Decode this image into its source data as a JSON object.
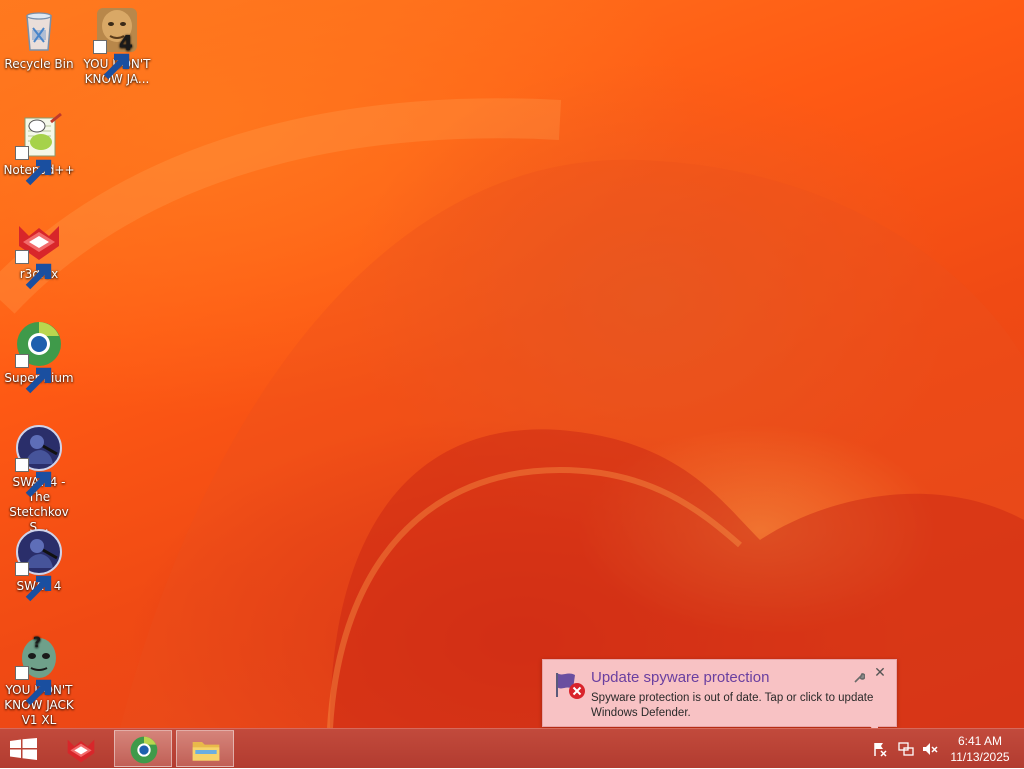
{
  "desktop": {
    "icons": [
      {
        "label": "Recycle Bin",
        "icon": "recycle-bin-icon"
      },
      {
        "label": "YOU DON'T KNOW JA...",
        "icon": "you-dont-know-jack-4-icon"
      },
      {
        "label": "Notepad++",
        "icon": "notepad-plus-plus-icon"
      },
      {
        "label": "r3dfox",
        "icon": "r3dfox-icon"
      },
      {
        "label": "Supermium",
        "icon": "supermium-icon"
      },
      {
        "label": "SWAT 4 - The Stetchkov S...",
        "icon": "swat-4-stetchkov-icon"
      },
      {
        "label": "SWAT 4",
        "icon": "swat-4-icon"
      },
      {
        "label": "YOU DON'T KNOW JACK V1 XL",
        "icon": "you-dont-know-jack-v1-xl-icon"
      }
    ]
  },
  "notification": {
    "title": "Update spyware protection",
    "message": "Spyware protection is out of date. Tap or click to update Windows Defender.",
    "icon": "windows-defender-error-icon",
    "accent_color": "#6a3fa0",
    "background_color": "#f8c2c4"
  },
  "taskbar": {
    "start_icon": "windows-logo-icon",
    "apps": [
      {
        "name": "r3dfox",
        "icon": "r3dfox-icon",
        "active": false
      },
      {
        "name": "Supermium",
        "icon": "supermium-icon",
        "active": true
      },
      {
        "name": "File Explorer",
        "icon": "file-explorer-icon",
        "active": true
      }
    ],
    "tray": [
      "action-center-flag-icon",
      "network-icon",
      "volume-muted-icon"
    ],
    "clock": {
      "time": "6:41 AM",
      "date": "11/13/2025"
    },
    "color": "#b8443a"
  }
}
